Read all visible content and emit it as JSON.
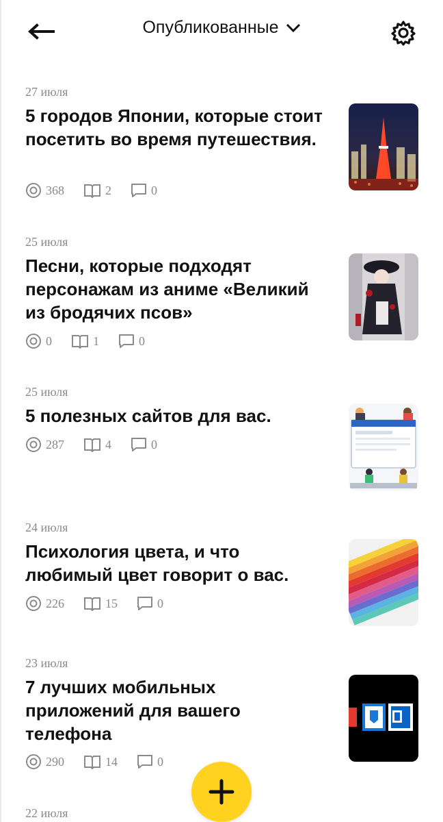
{
  "header": {
    "title": "Опубликованные"
  },
  "articles": [
    {
      "date": "27 июля",
      "title": "5 городов Японии, которые стоит посетить во время путешествия.",
      "views": "368",
      "reads": "2",
      "comments": "0"
    },
    {
      "date": "25 июля",
      "title": "Песни, которые подходят персонажам из аниме «Великий из бродячих псов»",
      "views": "0",
      "reads": "1",
      "comments": "0"
    },
    {
      "date": "25 июля",
      "title": "5 полезных сайтов для вас.",
      "views": "287",
      "reads": "4",
      "comments": "0"
    },
    {
      "date": "24 июля",
      "title": "Психология цвета, и что любимый цвет говорит о вас.",
      "views": "226",
      "reads": "15",
      "comments": "0"
    },
    {
      "date": "23 июля",
      "title": "7 лучших мобильных приложений для вашего телефона",
      "views": "290",
      "reads": "14",
      "comments": "0"
    },
    {
      "date": "22 июля"
    }
  ],
  "icons": {
    "back": "arrow-left-icon",
    "dropdown": "chevron-down-icon",
    "settings": "gear-icon",
    "views": "eye-icon",
    "reads": "book-icon",
    "comments": "comment-icon",
    "add": "plus-icon"
  },
  "colors": {
    "accent": "#ffd21f",
    "muted": "#8a8a8a",
    "text": "#111111"
  }
}
